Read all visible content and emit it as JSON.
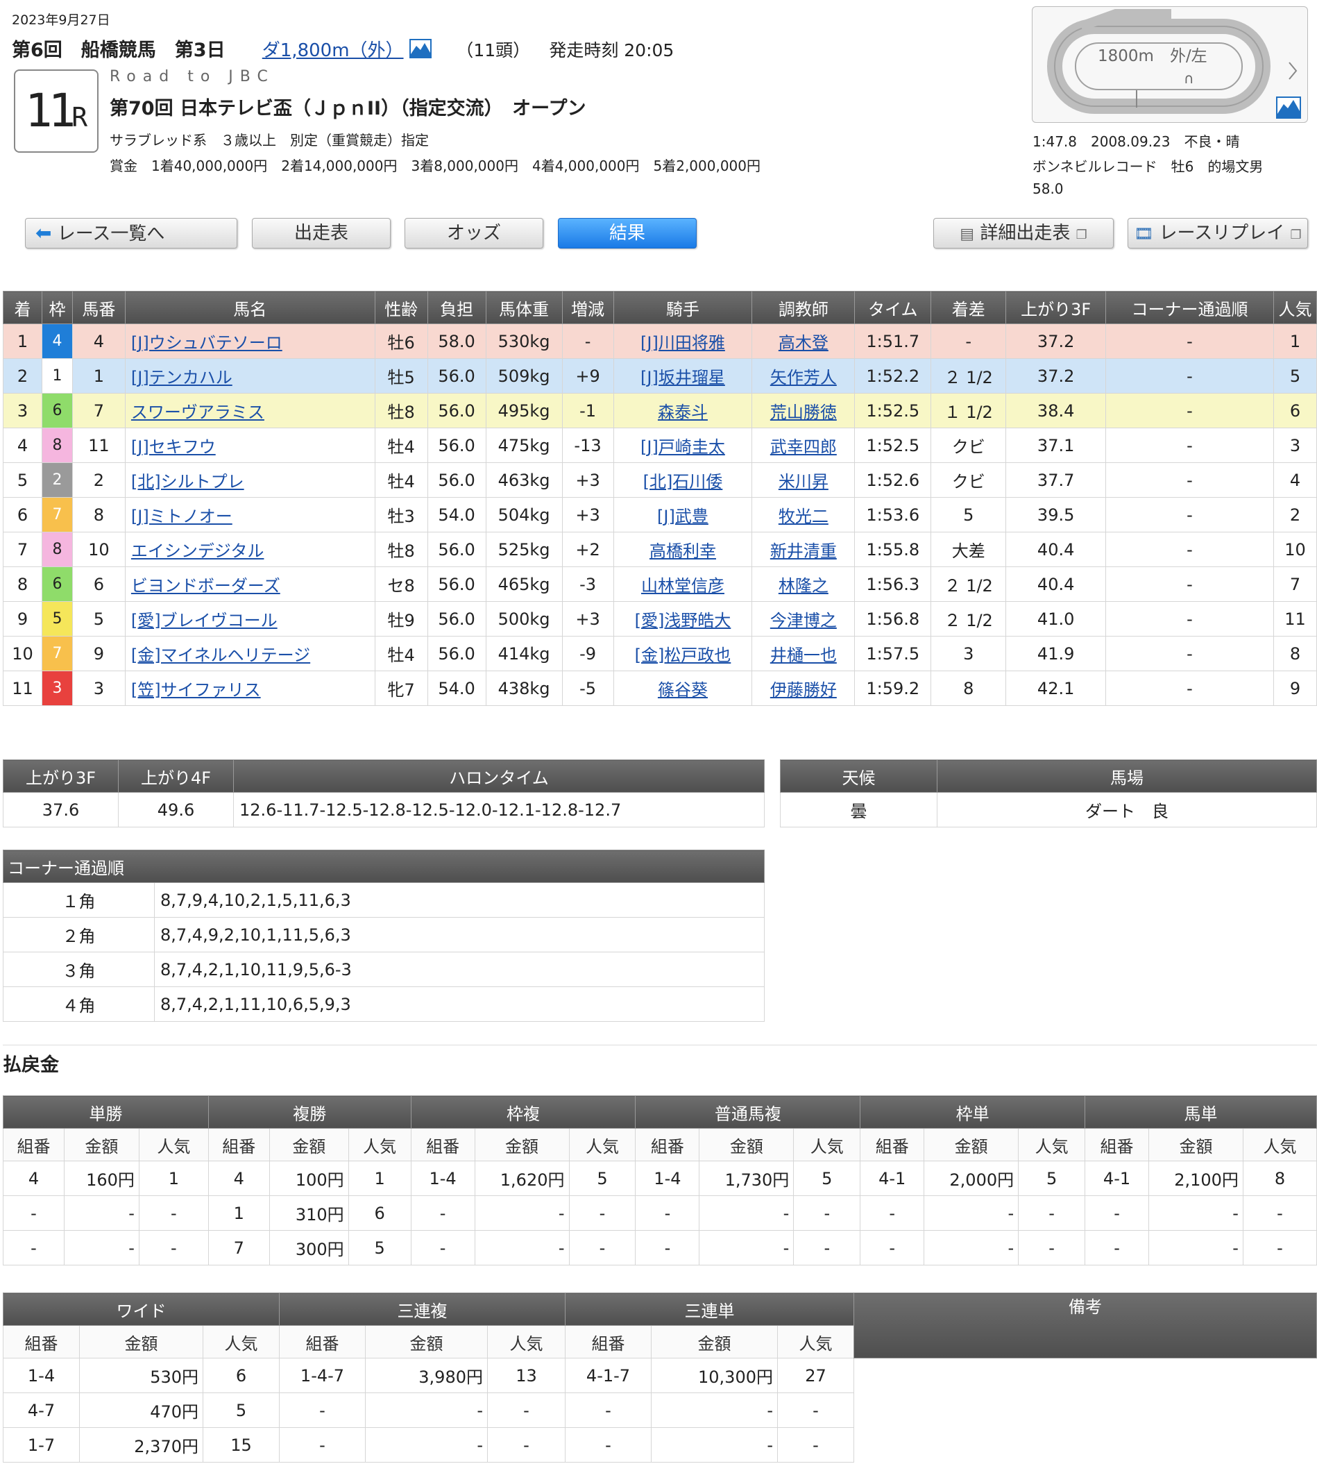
{
  "header": {
    "date": "2023年9月27日",
    "meeting": "第6回　船橋競馬　第3日",
    "distance_link": "ダ1,800m（外）",
    "runners": "（11頭）",
    "post_time": "発走時刻 20:05",
    "race_no": "11",
    "race_no_suffix": "R",
    "subtitle": "Road to JBC",
    "race_name": "第70回 日本テレビ盃（ＪｐｎII）（指定交流）　オープン",
    "conditions": "サラブレッド系　３歳以上　別定（重賞競走）指定",
    "prize": "賞金　1着40,000,000円　2着14,000,000円　3着8,000,000円　4着4,000,000円　5着2,000,000円"
  },
  "course": {
    "label": "1800m　外/左",
    "record_line1": "1:47.8　2008.09.23　不良・晴",
    "record_line2": "ボンネビルレコード　牡6　的場文男",
    "record_line3": "58.0"
  },
  "nav": {
    "race_list": "レース一覧へ",
    "entries": "出走表",
    "odds": "オッズ",
    "results": "結果",
    "detail_entries": "詳細出走表",
    "replay": "レースリプレイ"
  },
  "results": {
    "headers": [
      "着",
      "枠",
      "馬番",
      "馬名",
      "性齢",
      "負担",
      "馬体重",
      "増減",
      "騎手",
      "調教師",
      "タイム",
      "着差",
      "上がり3F",
      "コーナー通過順",
      "人気"
    ],
    "rows": [
      {
        "pos": "1",
        "waku": "4",
        "num": "4",
        "horse": "[J]ウシュバテソーロ",
        "sa": "牡6",
        "wt": "58.0",
        "bw": "530kg",
        "diff": "-",
        "jockey": "[J]川田将雅",
        "trainer": "高木登",
        "time": "1:51.7",
        "margin": "-",
        "last3f": "37.2",
        "corner": "-",
        "pop": "1"
      },
      {
        "pos": "2",
        "waku": "1",
        "num": "1",
        "horse": "[J]テンカハル",
        "sa": "牡5",
        "wt": "56.0",
        "bw": "509kg",
        "diff": "+9",
        "jockey": "[J]坂井瑠星",
        "trainer": "矢作芳人",
        "time": "1:52.2",
        "margin": "２ 1/2",
        "last3f": "37.2",
        "corner": "-",
        "pop": "5"
      },
      {
        "pos": "3",
        "waku": "6",
        "num": "7",
        "horse": "スワーヴアラミス",
        "sa": "牡8",
        "wt": "56.0",
        "bw": "495kg",
        "diff": "-1",
        "jockey": "森泰斗",
        "trainer": "荒山勝徳",
        "time": "1:52.5",
        "margin": "１ 1/2",
        "last3f": "38.4",
        "corner": "-",
        "pop": "6"
      },
      {
        "pos": "4",
        "waku": "8",
        "num": "11",
        "horse": "[J]セキフウ",
        "sa": "牡4",
        "wt": "56.0",
        "bw": "475kg",
        "diff": "-13",
        "jockey": "[J]戸崎圭太",
        "trainer": "武幸四郎",
        "time": "1:52.5",
        "margin": "クビ",
        "last3f": "37.1",
        "corner": "-",
        "pop": "3"
      },
      {
        "pos": "5",
        "waku": "2",
        "num": "2",
        "horse": "[北]シルトプレ",
        "sa": "牡4",
        "wt": "56.0",
        "bw": "463kg",
        "diff": "+3",
        "jockey": "[北]石川倭",
        "trainer": "米川昇",
        "time": "1:52.6",
        "margin": "クビ",
        "last3f": "37.7",
        "corner": "-",
        "pop": "4"
      },
      {
        "pos": "6",
        "waku": "7",
        "num": "8",
        "horse": "[J]ミトノオー",
        "sa": "牡3",
        "wt": "54.0",
        "bw": "504kg",
        "diff": "+3",
        "jockey": "[J]武豊",
        "trainer": "牧光二",
        "time": "1:53.6",
        "margin": "5",
        "last3f": "39.5",
        "corner": "-",
        "pop": "2"
      },
      {
        "pos": "7",
        "waku": "8",
        "num": "10",
        "horse": "エイシンデジタル",
        "sa": "牡8",
        "wt": "56.0",
        "bw": "525kg",
        "diff": "+2",
        "jockey": "高橋利幸",
        "trainer": "新井清重",
        "time": "1:55.8",
        "margin": "大差",
        "last3f": "40.4",
        "corner": "-",
        "pop": "10"
      },
      {
        "pos": "8",
        "waku": "6",
        "num": "6",
        "horse": "ビヨンドボーダーズ",
        "sa": "セ8",
        "wt": "56.0",
        "bw": "465kg",
        "diff": "-3",
        "jockey": "山林堂信彦",
        "trainer": "林隆之",
        "time": "1:56.3",
        "margin": "２ 1/2",
        "last3f": "40.4",
        "corner": "-",
        "pop": "7"
      },
      {
        "pos": "9",
        "waku": "5",
        "num": "5",
        "horse": "[愛]ブレイヴコール",
        "sa": "牡9",
        "wt": "56.0",
        "bw": "500kg",
        "diff": "+3",
        "jockey": "[愛]浅野皓大",
        "trainer": "今津博之",
        "time": "1:56.8",
        "margin": "２ 1/2",
        "last3f": "41.0",
        "corner": "-",
        "pop": "11"
      },
      {
        "pos": "10",
        "waku": "7",
        "num": "9",
        "horse": "[金]マイネルヘリテージ",
        "sa": "牡4",
        "wt": "56.0",
        "bw": "414kg",
        "diff": "-9",
        "jockey": "[金]松戸政也",
        "trainer": "井樋一也",
        "time": "1:57.5",
        "margin": "3",
        "last3f": "41.9",
        "corner": "-",
        "pop": "8"
      },
      {
        "pos": "11",
        "waku": "3",
        "num": "3",
        "horse": "[笠]サイファリス",
        "sa": "牝7",
        "wt": "54.0",
        "bw": "438kg",
        "diff": "-5",
        "jockey": "篠谷葵",
        "trainer": "伊藤勝好",
        "time": "1:59.2",
        "margin": "8",
        "last3f": "42.1",
        "corner": "-",
        "pop": "9"
      }
    ]
  },
  "laps": {
    "headers": [
      "上がり3F",
      "上がり4F",
      "ハロンタイム"
    ],
    "values": [
      "37.6",
      "49.6",
      "12.6-11.7-12.5-12.8-12.5-12.0-12.1-12.8-12.7"
    ]
  },
  "weather": {
    "headers": [
      "天候",
      "馬場"
    ],
    "values": [
      "曇",
      "ダート　良"
    ]
  },
  "corners": {
    "title": "コーナー通過順",
    "rows": [
      {
        "label": "１角",
        "order": "8,7,9,4,10,2,1,5,11,6,3"
      },
      {
        "label": "２角",
        "order": "8,7,4,9,2,10,1,11,5,6,3"
      },
      {
        "label": "３角",
        "order": "8,7,4,2,1,10,11,9,5,6-3"
      },
      {
        "label": "４角",
        "order": "8,7,4,2,1,11,10,6,5,9,3"
      }
    ]
  },
  "payout": {
    "title": "払戻金",
    "groups1": [
      "単勝",
      "複勝",
      "枠複",
      "普通馬複",
      "枠単",
      "馬単"
    ],
    "groups2": [
      "ワイド",
      "三連複",
      "三連単",
      "備考"
    ],
    "sub": [
      "組番",
      "金額",
      "人気"
    ],
    "rows1": [
      [
        "4",
        "160円",
        "1",
        "4",
        "100円",
        "1",
        "1-4",
        "1,620円",
        "5",
        "1-4",
        "1,730円",
        "5",
        "4-1",
        "2,000円",
        "5",
        "4-1",
        "2,100円",
        "8"
      ],
      [
        "-",
        "-",
        "-",
        "1",
        "310円",
        "6",
        "-",
        "-",
        "-",
        "-",
        "-",
        "-",
        "-",
        "-",
        "-",
        "-",
        "-",
        "-"
      ],
      [
        "-",
        "-",
        "-",
        "7",
        "300円",
        "5",
        "-",
        "-",
        "-",
        "-",
        "-",
        "-",
        "-",
        "-",
        "-",
        "-",
        "-",
        "-"
      ]
    ],
    "rows2": [
      [
        "1-4",
        "530円",
        "6",
        "1-4-7",
        "3,980円",
        "13",
        "4-1-7",
        "10,300円",
        "27"
      ],
      [
        "4-7",
        "470円",
        "5",
        "-",
        "-",
        "-",
        "-",
        "-",
        "-"
      ],
      [
        "1-7",
        "2,370円",
        "15",
        "-",
        "-",
        "-",
        "-",
        "-",
        "-"
      ]
    ]
  },
  "colors": {
    "row1": "#f8d8d0",
    "row2": "#cfe4f7",
    "row3": "#f8f7c6",
    "waku1": "#ffffff",
    "waku2": "#9a9a9a",
    "waku3": "#e8413e",
    "waku4": "#1f7ed8",
    "waku5": "#f5e65a",
    "waku6": "#8fdc6a",
    "waku7": "#f8c04c",
    "waku8": "#f5b6df"
  }
}
